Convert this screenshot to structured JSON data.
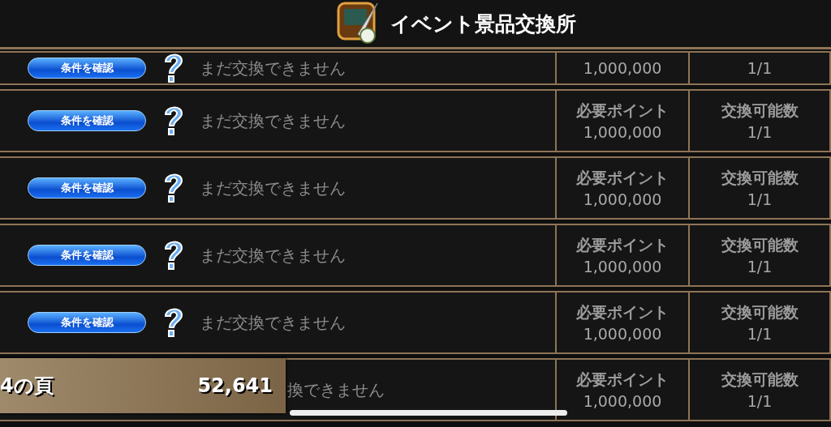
{
  "header": {
    "title": "イベント景品交換所"
  },
  "rows": [
    {
      "kind": "partial",
      "button": "条件を確認",
      "status": "まだ交換できません",
      "points": "1,000,000",
      "count": "1/1"
    },
    {
      "kind": "full",
      "button": "条件を確認",
      "status": "まだ交換できません",
      "points_label": "必要ポイント",
      "points": "1,000,000",
      "count_label": "交換可能数",
      "count": "1/1"
    },
    {
      "kind": "full",
      "button": "条件を確認",
      "status": "まだ交換できません",
      "points_label": "必要ポイント",
      "points": "1,000,000",
      "count_label": "交換可能数",
      "count": "1/1"
    },
    {
      "kind": "full",
      "button": "条件を確認",
      "status": "まだ交換できません",
      "points_label": "必要ポイント",
      "points": "1,000,000",
      "count_label": "交換可能数",
      "count": "1/1"
    },
    {
      "kind": "full",
      "button": "条件を確認",
      "status": "まだ交換できません",
      "points_label": "必要ポイント",
      "points": "1,000,000",
      "count_label": "交換可能数",
      "count": "1/1"
    },
    {
      "kind": "covered",
      "status": "換できません",
      "points_label": "必要ポイント",
      "points": "1,000,000",
      "count_label": "交換可能数",
      "count": "1/1"
    }
  ],
  "item_panel": {
    "name": "4の頁",
    "amount": "52,641"
  }
}
